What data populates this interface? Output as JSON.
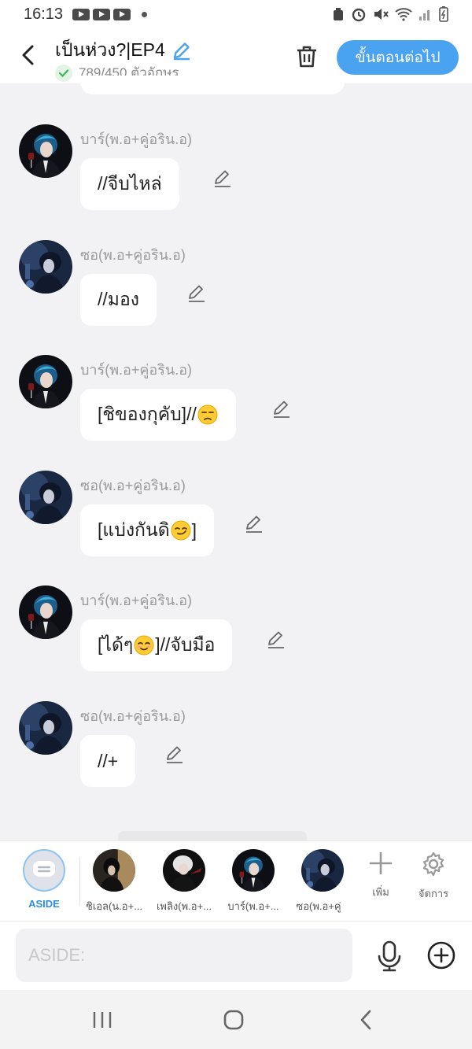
{
  "status_bar": {
    "time": "16:13"
  },
  "header": {
    "title": "เป็นห่วง?|EP4",
    "char_count": "789/450 ตัวอักษร",
    "next_label": "ขั้นตอนต่อไป"
  },
  "messages": [
    {
      "sender": "บาร์(พ.อ+คู่อริน.อ)",
      "avatar": "bar",
      "text": "//จีบไหล่"
    },
    {
      "sender": "ซอ(พ.อ+คู่อริน.อ)",
      "avatar": "so",
      "text": "//มอง"
    },
    {
      "sender": "บาร์(พ.อ+คู่อริน.อ)",
      "avatar": "bar",
      "text_before": "[ชิของกุคับ]//",
      "emoji": "unamused-face",
      "text_after": ""
    },
    {
      "sender": "ซอ(พ.อ+คู่อริน.อ)",
      "avatar": "so",
      "text_before": "[แบ่งกันดิ",
      "emoji": "smirking-face",
      "text_after": "]"
    },
    {
      "sender": "บาร์(พ.อ+คู่อริน.อ)",
      "avatar": "bar",
      "text_before": "[ได้ๆ",
      "emoji": "smiling-face",
      "text_after": "]//จับมือ"
    },
    {
      "sender": "ซอ(พ.อ+คู่อริน.อ)",
      "avatar": "so",
      "text": "//+"
    }
  ],
  "characters": [
    {
      "label": "ASIDE"
    },
    {
      "label": "ชิเอล(น.อ+..."
    },
    {
      "label": "เพลิง(พ.อ+..."
    },
    {
      "label": "บาร์(พ.อ+..."
    },
    {
      "label": "ซอ(พ.อ+คู่"
    }
  ],
  "tools": {
    "add_label": "เพิ่ม",
    "manage_label": "จัดการ"
  },
  "input": {
    "placeholder": "ASIDE:"
  },
  "colors": {
    "accent": "#4aa3f0",
    "background": "#f2f2f4"
  }
}
